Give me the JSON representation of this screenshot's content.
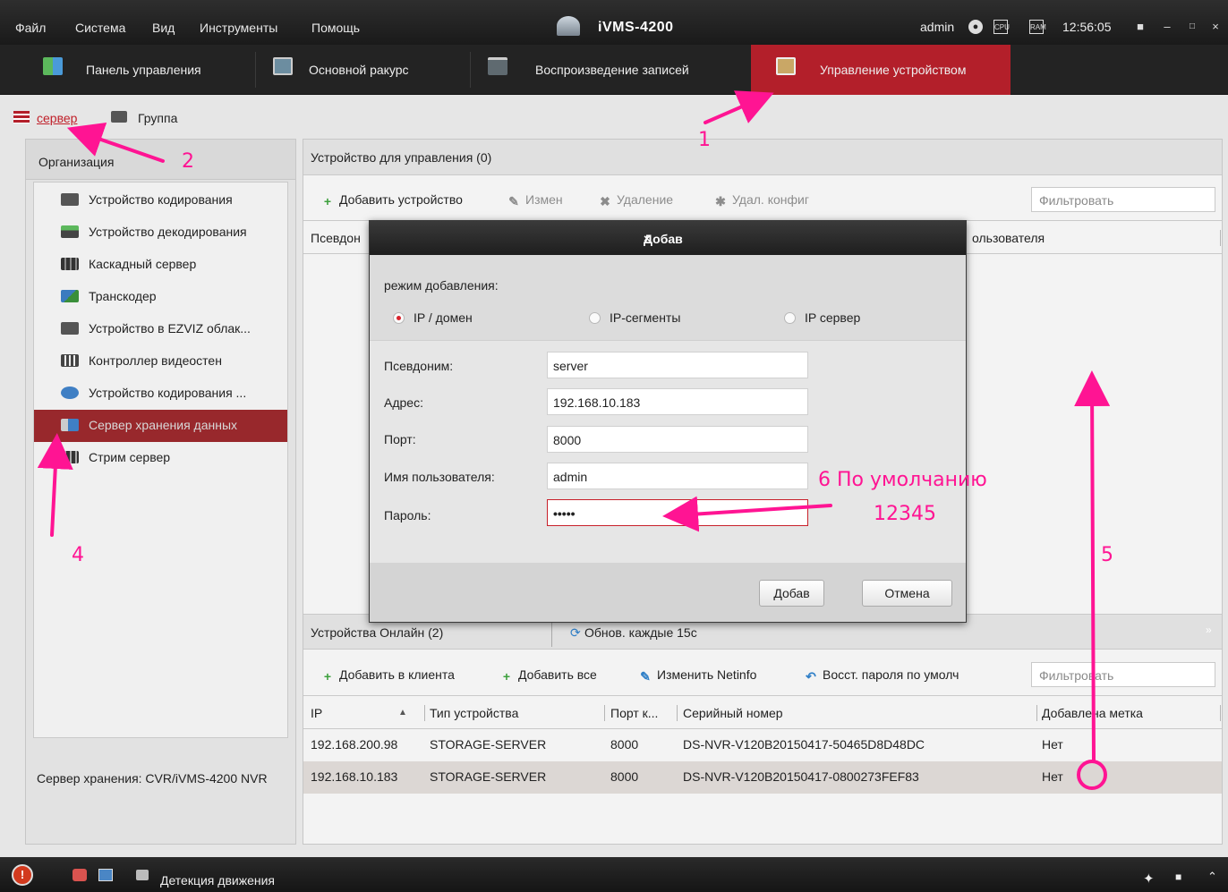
{
  "titlebar": {
    "menu": [
      "Файл",
      "Система",
      "Вид",
      "Инструменты",
      "Помощь"
    ],
    "app_title": "iVMS-4200",
    "user": "admin",
    "clock": "12:56:05"
  },
  "modules": [
    {
      "label": "Панель управления"
    },
    {
      "label": "Основной ракурс"
    },
    {
      "label": "Воспроизведение записей"
    },
    {
      "label": "Управление устройством",
      "active": true
    }
  ],
  "subtabs": {
    "server": "сервер",
    "group": "Группа"
  },
  "left": {
    "header": "Организация",
    "items": [
      "Устройство кодирования",
      "Устройство декодирования",
      "Каскадный сервер",
      "Транскодер",
      "Устройство в EZVIZ облак...",
      "Контроллер видеостен",
      "Устройство кодирования ...",
      "Сервер хранения данных",
      "Стрим сервер"
    ],
    "selected_index": 7,
    "info": "Сервер хранения: CVR/iVMS-4200 NVR"
  },
  "managed": {
    "header": "Устройство для управления (0)",
    "toolbar": {
      "add": "Добавить устройство",
      "edit": "Измен",
      "delete": "Удаление",
      "remote_config": "Удал. конфиг",
      "filter_placeholder": "Фильтровать"
    },
    "col_alias": "Псевдон",
    "col_user": "ользователя"
  },
  "online": {
    "header": "Устройства Онлайн (2)",
    "refresh": "Обнов. каждые 15с",
    "toolbar": {
      "add_client": "Добавить в клиента",
      "add_all": "Добавить все",
      "netinfo": "Изменить Netinfo",
      "reset_pw": "Восст. пароля по умолч",
      "filter_placeholder": "Фильтровать"
    },
    "columns": {
      "ip": "IP",
      "type": "Тип устройства",
      "port": "Порт к...",
      "serial": "Серийный номер",
      "added": "Добавлена метка"
    },
    "rows": [
      {
        "ip": "192.168.200.98",
        "type": "STORAGE-SERVER",
        "port": "8000",
        "serial": "DS-NVR-V120B20150417-50465D8D48DC",
        "added": "Нет"
      },
      {
        "ip": "192.168.10.183",
        "type": "STORAGE-SERVER",
        "port": "8000",
        "serial": "DS-NVR-V120B20150417-0800273FEF83",
        "added": "Нет"
      }
    ],
    "selected_row": 1
  },
  "dialog": {
    "title": "Добав",
    "mode_label": "режим добавления:",
    "modes": [
      "IP / домен",
      "IP-сегменты",
      "IP сервер"
    ],
    "selected_mode": 0,
    "fields": {
      "alias_label": "Псевдоним:",
      "alias": "server",
      "address_label": "Адрес:",
      "address": "192.168.10.183",
      "port_label": "Порт:",
      "port": "8000",
      "user_label": "Имя пользователя:",
      "user": "admin",
      "password_label": "Пароль:",
      "password": "•••••"
    },
    "ok": "Добав",
    "cancel": "Отмена"
  },
  "taskbar": {
    "status": "Детекция движения"
  },
  "annotations": {
    "n1": "1",
    "n2": "2",
    "n4": "4",
    "n5": "5",
    "n6": "6 По умолчанию",
    "n6b": "12345"
  },
  "colors": {
    "accent": "#b31f2a",
    "selected": "#98282c",
    "annotation": "#ff1493"
  }
}
